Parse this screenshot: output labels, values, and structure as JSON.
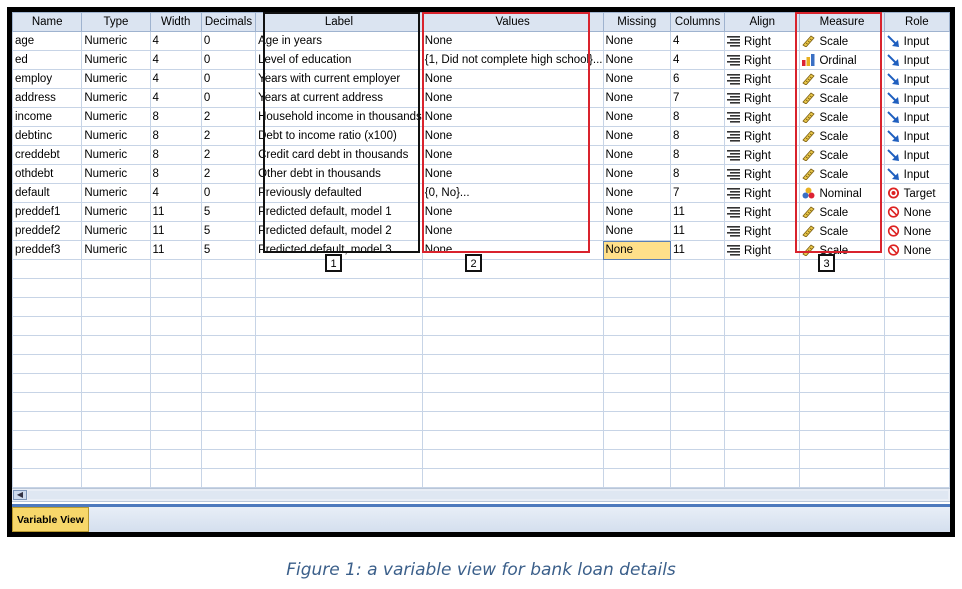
{
  "columns": [
    "Name",
    "Type",
    "Width",
    "Decimals",
    "Label",
    "Values",
    "Missing",
    "Columns",
    "Align",
    "Measure",
    "Role"
  ],
  "rows": [
    {
      "name": "age",
      "type": "Numeric",
      "width": "4",
      "decimals": "0",
      "label": "Age in years",
      "values": "None",
      "missing": "None",
      "columns": "4",
      "align": "Right",
      "measure": "Scale",
      "measure_icon": "ruler-icon",
      "role": "Input",
      "role_icon": "input-arrow-icon"
    },
    {
      "name": "ed",
      "type": "Numeric",
      "width": "4",
      "decimals": "0",
      "label": "Level of education",
      "values": "{1, Did not complete high school}...",
      "missing": "None",
      "columns": "4",
      "align": "Right",
      "measure": "Ordinal",
      "measure_icon": "bar-chart-icon",
      "role": "Input",
      "role_icon": "input-arrow-icon"
    },
    {
      "name": "employ",
      "type": "Numeric",
      "width": "4",
      "decimals": "0",
      "label": "Years with current employer",
      "values": "None",
      "missing": "None",
      "columns": "6",
      "align": "Right",
      "measure": "Scale",
      "measure_icon": "ruler-icon",
      "role": "Input",
      "role_icon": "input-arrow-icon"
    },
    {
      "name": "address",
      "type": "Numeric",
      "width": "4",
      "decimals": "0",
      "label": "Years at current address",
      "values": "None",
      "missing": "None",
      "columns": "7",
      "align": "Right",
      "measure": "Scale",
      "measure_icon": "ruler-icon",
      "role": "Input",
      "role_icon": "input-arrow-icon"
    },
    {
      "name": "income",
      "type": "Numeric",
      "width": "8",
      "decimals": "2",
      "label": "Household income in thousands",
      "values": "None",
      "missing": "None",
      "columns": "8",
      "align": "Right",
      "measure": "Scale",
      "measure_icon": "ruler-icon",
      "role": "Input",
      "role_icon": "input-arrow-icon"
    },
    {
      "name": "debtinc",
      "type": "Numeric",
      "width": "8",
      "decimals": "2",
      "label": "Debt to income ratio (x100)",
      "values": "None",
      "missing": "None",
      "columns": "8",
      "align": "Right",
      "measure": "Scale",
      "measure_icon": "ruler-icon",
      "role": "Input",
      "role_icon": "input-arrow-icon"
    },
    {
      "name": "creddebt",
      "type": "Numeric",
      "width": "8",
      "decimals": "2",
      "label": "Credit card debt in thousands",
      "values": "None",
      "missing": "None",
      "columns": "8",
      "align": "Right",
      "measure": "Scale",
      "measure_icon": "ruler-icon",
      "role": "Input",
      "role_icon": "input-arrow-icon"
    },
    {
      "name": "othdebt",
      "type": "Numeric",
      "width": "8",
      "decimals": "2",
      "label": "Other debt in thousands",
      "values": "None",
      "missing": "None",
      "columns": "8",
      "align": "Right",
      "measure": "Scale",
      "measure_icon": "ruler-icon",
      "role": "Input",
      "role_icon": "input-arrow-icon"
    },
    {
      "name": "default",
      "type": "Numeric",
      "width": "4",
      "decimals": "0",
      "label": "Previously defaulted",
      "values": "{0, No}...",
      "missing": "None",
      "columns": "7",
      "align": "Right",
      "measure": "Nominal",
      "measure_icon": "nominal-balls-icon",
      "role": "Target",
      "role_icon": "target-icon"
    },
    {
      "name": "preddef1",
      "type": "Numeric",
      "width": "11",
      "decimals": "5",
      "label": "Predicted default, model 1",
      "values": "None",
      "missing": "None",
      "columns": "11",
      "align": "Right",
      "measure": "Scale",
      "measure_icon": "ruler-icon",
      "role": "None",
      "role_icon": "none-icon"
    },
    {
      "name": "preddef2",
      "type": "Numeric",
      "width": "11",
      "decimals": "5",
      "label": "Predicted default, model 2",
      "values": "None",
      "missing": "None",
      "columns": "11",
      "align": "Right",
      "measure": "Scale",
      "measure_icon": "ruler-icon",
      "role": "None",
      "role_icon": "none-icon"
    },
    {
      "name": "preddef3",
      "type": "Numeric",
      "width": "11",
      "decimals": "5",
      "label": "Predicted default, model 3",
      "values": "None",
      "missing": "None",
      "columns": "11",
      "align": "Right",
      "measure": "Scale",
      "measure_icon": "ruler-icon",
      "role": "None",
      "role_icon": "none-icon",
      "selected": "missing"
    }
  ],
  "empty_rows": 12,
  "annotations": [
    "1",
    "2",
    "3"
  ],
  "tab_label": "Variable View",
  "caption": "Figure 1: a variable view for bank loan details",
  "colors": {
    "header_bg": "#dbe4f1",
    "grid_line": "#c7d4e6",
    "selection": "#ffe08a",
    "box_red": "#d9232d",
    "box_black": "#111111",
    "tab_active": "#f7d76a",
    "caption": "#3b5f8a"
  }
}
